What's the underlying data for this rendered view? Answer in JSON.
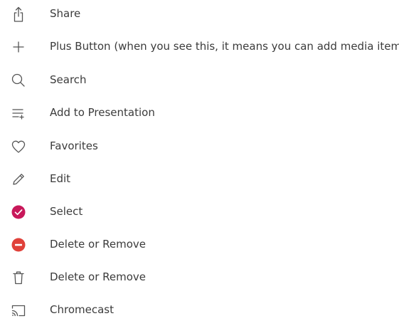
{
  "legend": {
    "items": [
      {
        "icon": "share-icon",
        "label": "Share"
      },
      {
        "icon": "plus-icon",
        "label": "Plus Button (when you see this, it means you can add media items)"
      },
      {
        "icon": "search-icon",
        "label": "Search"
      },
      {
        "icon": "add-to-playlist-icon",
        "label": "Add to Presentation"
      },
      {
        "icon": "heart-icon",
        "label": "Favorites"
      },
      {
        "icon": "pencil-icon",
        "label": "Edit"
      },
      {
        "icon": "check-circle-icon",
        "label": "Select"
      },
      {
        "icon": "minus-circle-icon",
        "label": "Delete or Remove"
      },
      {
        "icon": "trash-icon",
        "label": "Delete or Remove"
      },
      {
        "icon": "cast-icon",
        "label": "Chromecast"
      }
    ]
  },
  "colors": {
    "icon_stroke": "#555555",
    "text": "#3b3b3b",
    "select_accent": "#c8185a",
    "delete_accent": "#e0413a"
  }
}
